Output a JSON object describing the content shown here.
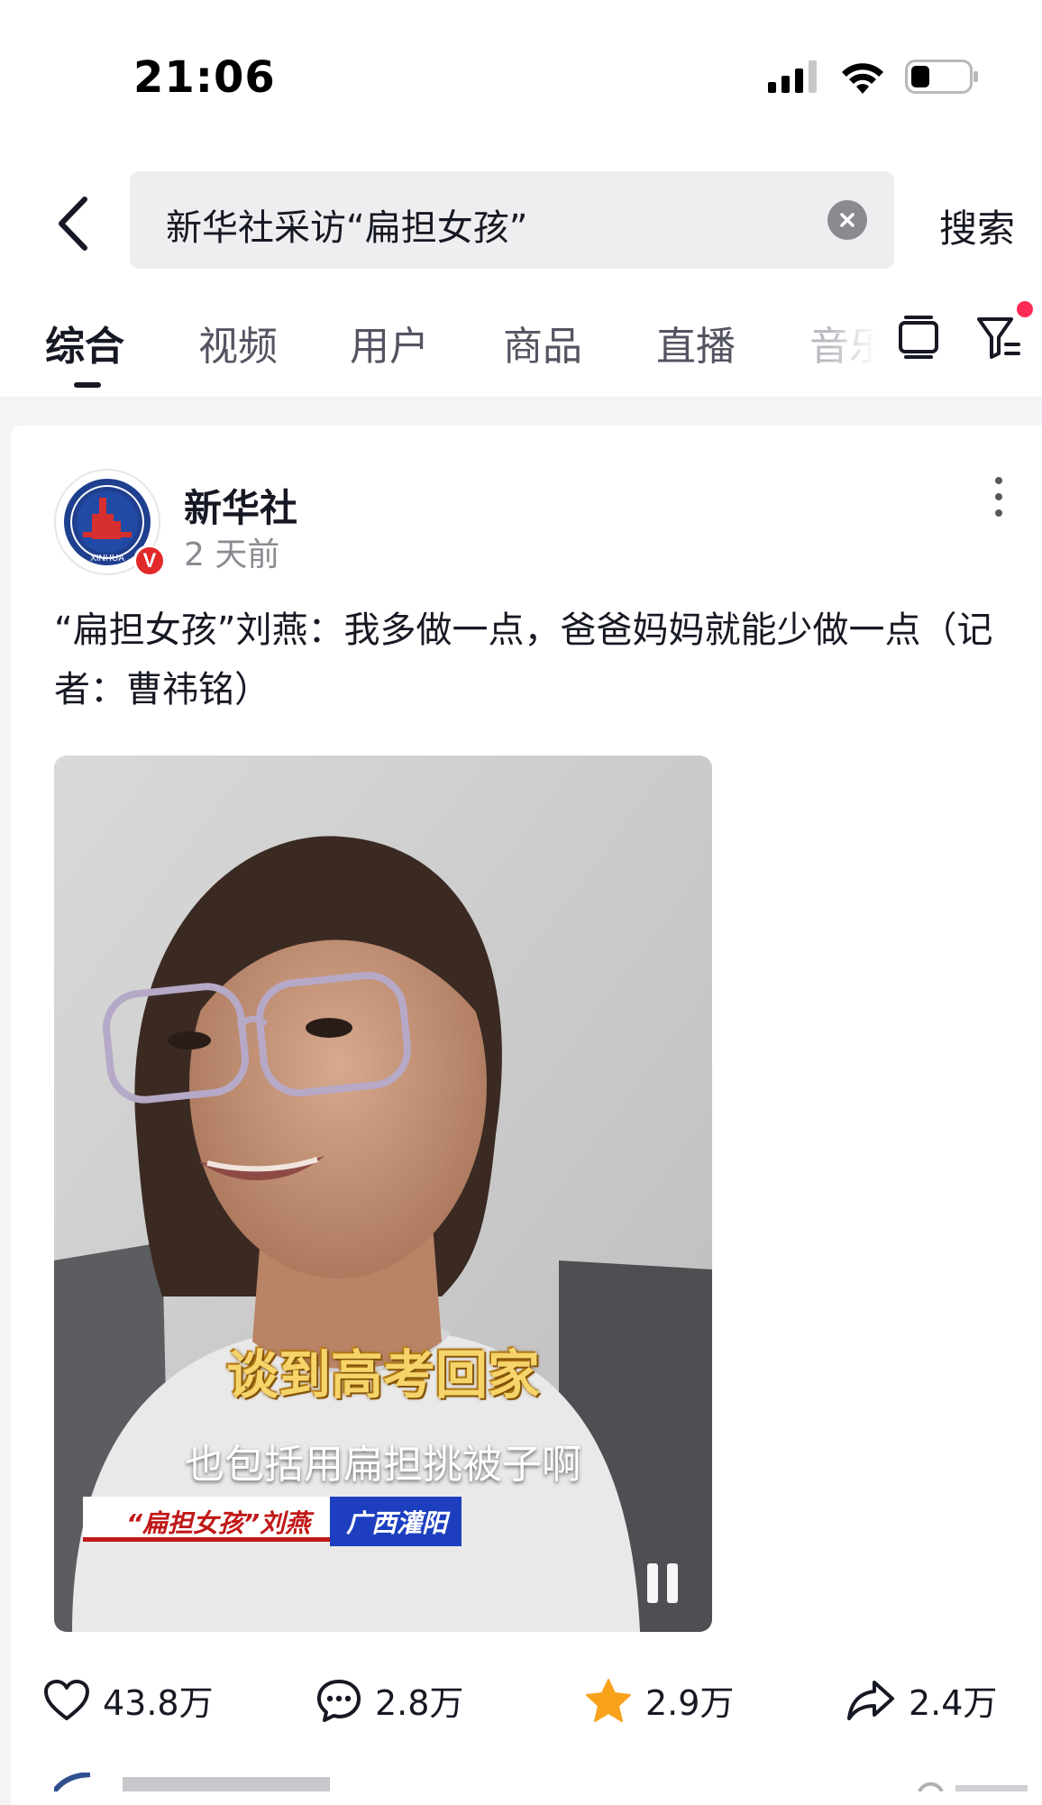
{
  "status_bar": {
    "time": "21:06",
    "icons": [
      "cellular-signal-icon",
      "wifi-icon",
      "battery-icon"
    ]
  },
  "search": {
    "query": "新华社采访“扁担女孩”",
    "submit_label": "搜索"
  },
  "tabs": {
    "items": [
      "综合",
      "视频",
      "用户",
      "商品",
      "直播",
      "音乐"
    ],
    "active": "综合",
    "has_filter_notification": true
  },
  "result": {
    "author": "新华社",
    "author_logo_text": "XINHUA",
    "verified": true,
    "time": "2 天前",
    "title": "“扁担女孩”刘燕：我多做一点，爸爸妈妈就能少做一点（记者：曹祎铭）",
    "video": {
      "caption_main": "谈到高考回家",
      "caption_sub": "也包括用扁担挑被子啊",
      "lower_third_name": "“扁担女孩”刘燕",
      "lower_third_place": "广西灌阳",
      "state": "playing"
    },
    "actions": {
      "likes": "43.8万",
      "comments": "2.8万",
      "favorites": "2.9万",
      "shares": "2.4万"
    }
  },
  "colors": {
    "accent_red": "#fe2c55",
    "favorite_star": "#f8a21c",
    "verified_badge": "#e32a2a",
    "place_blue": "#1d3fbf"
  }
}
